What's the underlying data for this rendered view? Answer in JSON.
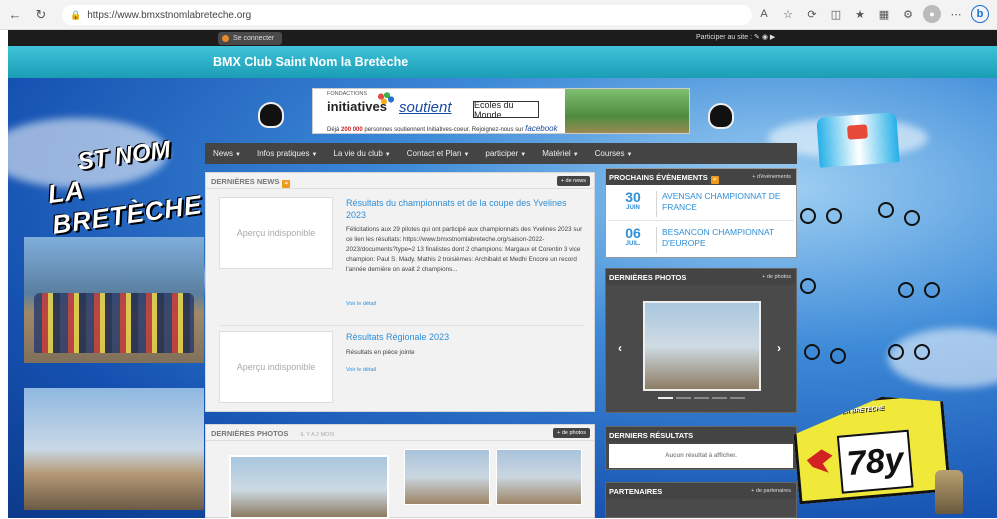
{
  "browser": {
    "url": "https://www.bmxstnomlabreteche.org",
    "back_icon": "arrow-left-icon",
    "reload_icon": "reload-icon"
  },
  "topbar": {
    "login_label": "Se connecter",
    "participate_label": "Participer au site :"
  },
  "site": {
    "title": "BMX Club Saint Nom la Bretèche",
    "logo_line1": "ST NOM",
    "logo_line2": "LA BRETÈCHE"
  },
  "ad": {
    "foundation": "FONDACTIONS",
    "brand": "initiatives",
    "tagline": "soutient",
    "partner": "Ecoles du Monde",
    "caption_prefix": "Déjà",
    "caption_count": "200 000",
    "caption_text": "personnes soutiennent Initiatives-coeur. Rejoignez-nous sur",
    "caption_link": "facebook"
  },
  "nav": {
    "items": [
      {
        "label": "News"
      },
      {
        "label": "Infos pratiques"
      },
      {
        "label": "La vie du club"
      },
      {
        "label": "Contact et Plan"
      },
      {
        "label": "participer"
      },
      {
        "label": "Matériel"
      },
      {
        "label": "Courses"
      }
    ]
  },
  "news": {
    "title": "Dernières news",
    "more_label": "+ de news",
    "items": [
      {
        "thumb_label": "Aperçu indisponible",
        "title": "Résultats du championnats et de la coupe des Yvelines 2023",
        "excerpt": "Félicitations aux 29 pilotes qui ont participé aux championnats des Yvelines 2023 sur ce lien les résultats: https://www.bmxstnomlabreteche.org/saison-2022-2023/documents?type=2 13 finalistes dont 2 champions: Margaux et Corentin 3 vice champion: Paul S. Mady. Mathis 2 troisièmes: Archibald et Medhi Encore un record l'année dernière on avait 2 champions...",
        "more": "Voir le détail"
      },
      {
        "thumb_label": "Aperçu indisponible",
        "title": "Résultats Régionale 2023",
        "excerpt": "Résultats en pièce jointe",
        "more": "Voir le détail"
      }
    ]
  },
  "photos_section": {
    "title": "Dernières photos",
    "time": "IL Y A 2 MOIS",
    "more_label": "+ de photos"
  },
  "events": {
    "title": "Prochains évènements",
    "more_label": "+ d'évènements",
    "items": [
      {
        "day": "30",
        "month": "JUIN",
        "name": "AVENSAN CHAMPIONNAT DE FRANCE"
      },
      {
        "day": "06",
        "month": "JUIL.",
        "name": "BESANCON CHAMPIONNAT D'EUROPE"
      }
    ]
  },
  "photos_box": {
    "title": "Dernières photos",
    "more_label": "+ de photos"
  },
  "results_box": {
    "title": "Derniers résultats",
    "empty": "Aucun résultat à afficher."
  },
  "partners_box": {
    "title": "Partenaires",
    "more_label": "+ de partenaires"
  },
  "plate": {
    "number": "78y",
    "logo": "ST NOM LA BRETÈCHE"
  }
}
